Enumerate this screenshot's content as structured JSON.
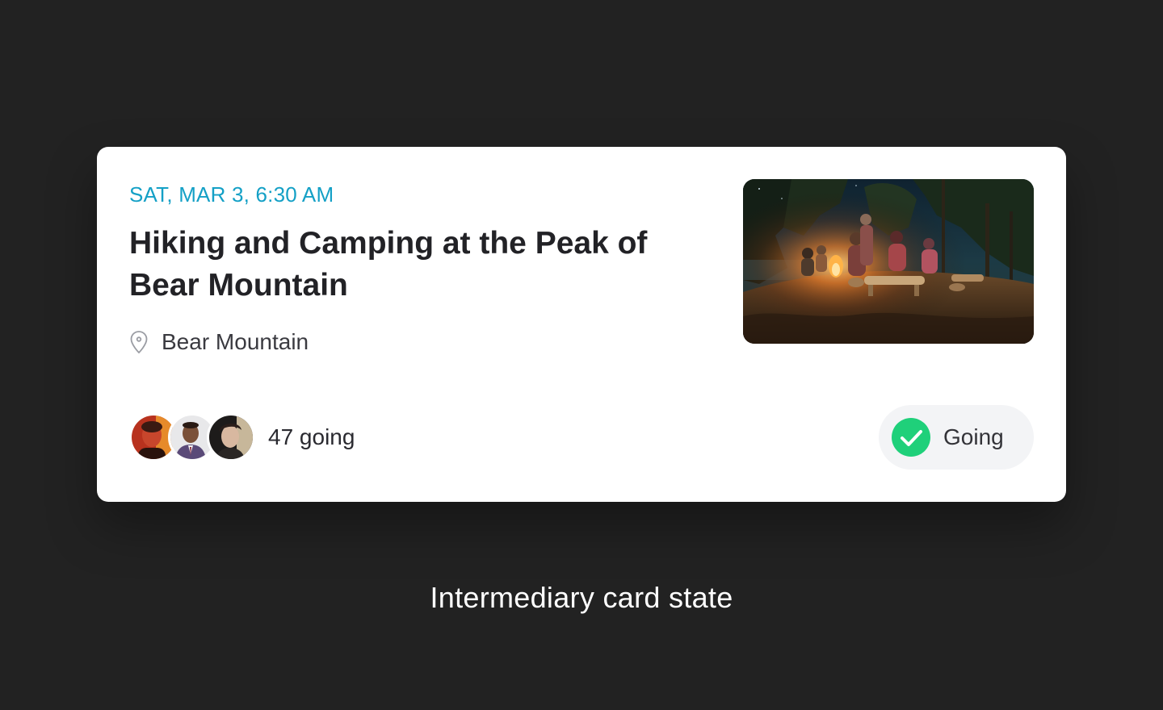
{
  "event_card": {
    "date_time": "SAT, MAR 3, 6:30 AM",
    "title": "Hiking and Camping at the Peak of Bear Mountain",
    "location": "Bear Mountain",
    "location_icon": "map-pin-icon",
    "photo_description_icon": "campfire-photo",
    "attendees": {
      "count_label": "47 going",
      "avatars": [
        "attendee-avatar-1",
        "attendee-avatar-2",
        "attendee-avatar-3"
      ]
    },
    "rsvp": {
      "label": "Going",
      "icon": "check-circle-icon",
      "status_color": "#1fd07a"
    },
    "accent_color": "#14a0c6"
  },
  "caption": "Intermediary card state"
}
